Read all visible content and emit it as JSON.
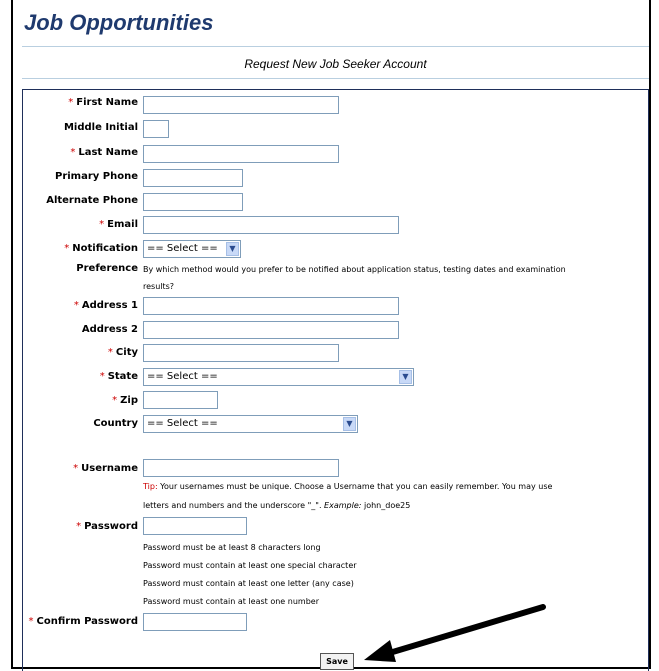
{
  "page": {
    "title": "Job Opportunities",
    "subtitle": "Request New Job Seeker Account"
  },
  "form": {
    "first_name_label": "First Name",
    "middle_initial_label": "Middle Initial",
    "last_name_label": "Last Name",
    "primary_phone_label": "Primary Phone",
    "alternate_phone_label": "Alternate Phone",
    "email_label": "Email",
    "notification_label": "Notification",
    "preference_label": "Preference",
    "notification_value": "== Select ==",
    "notification_help": "By which method would you prefer to be notified about application status, testing dates and examination",
    "notification_help2": "results?",
    "address1_label": "Address 1",
    "address2_label": "Address 2",
    "city_label": "City",
    "state_label": "State",
    "state_value": "== Select ==",
    "zip_label": "Zip",
    "country_label": "Country",
    "country_value": "== Select ==",
    "username_label": "Username",
    "username_tip_label": "Tip:",
    "username_tip_text": " Your usernames must be unique. Choose a Username that you can easily remember. You may use",
    "username_tip_text2": "letters and numbers and the underscore \"_\". ",
    "username_example_label": "Example:",
    "username_example_value": " john_doe25",
    "password_label": "Password",
    "password_rules": [
      "Password must be at least 8 characters long",
      "Password must contain at least one special character",
      "Password must contain at least one letter (any case)",
      "Password must contain at least one number"
    ],
    "confirm_password_label": "Confirm Password",
    "required_marker": "*",
    "save_label": "Save"
  },
  "icons": {
    "dropdown_arrow": "chevron-down-icon",
    "pointer_arrow": "arrow-pointer-icon"
  }
}
